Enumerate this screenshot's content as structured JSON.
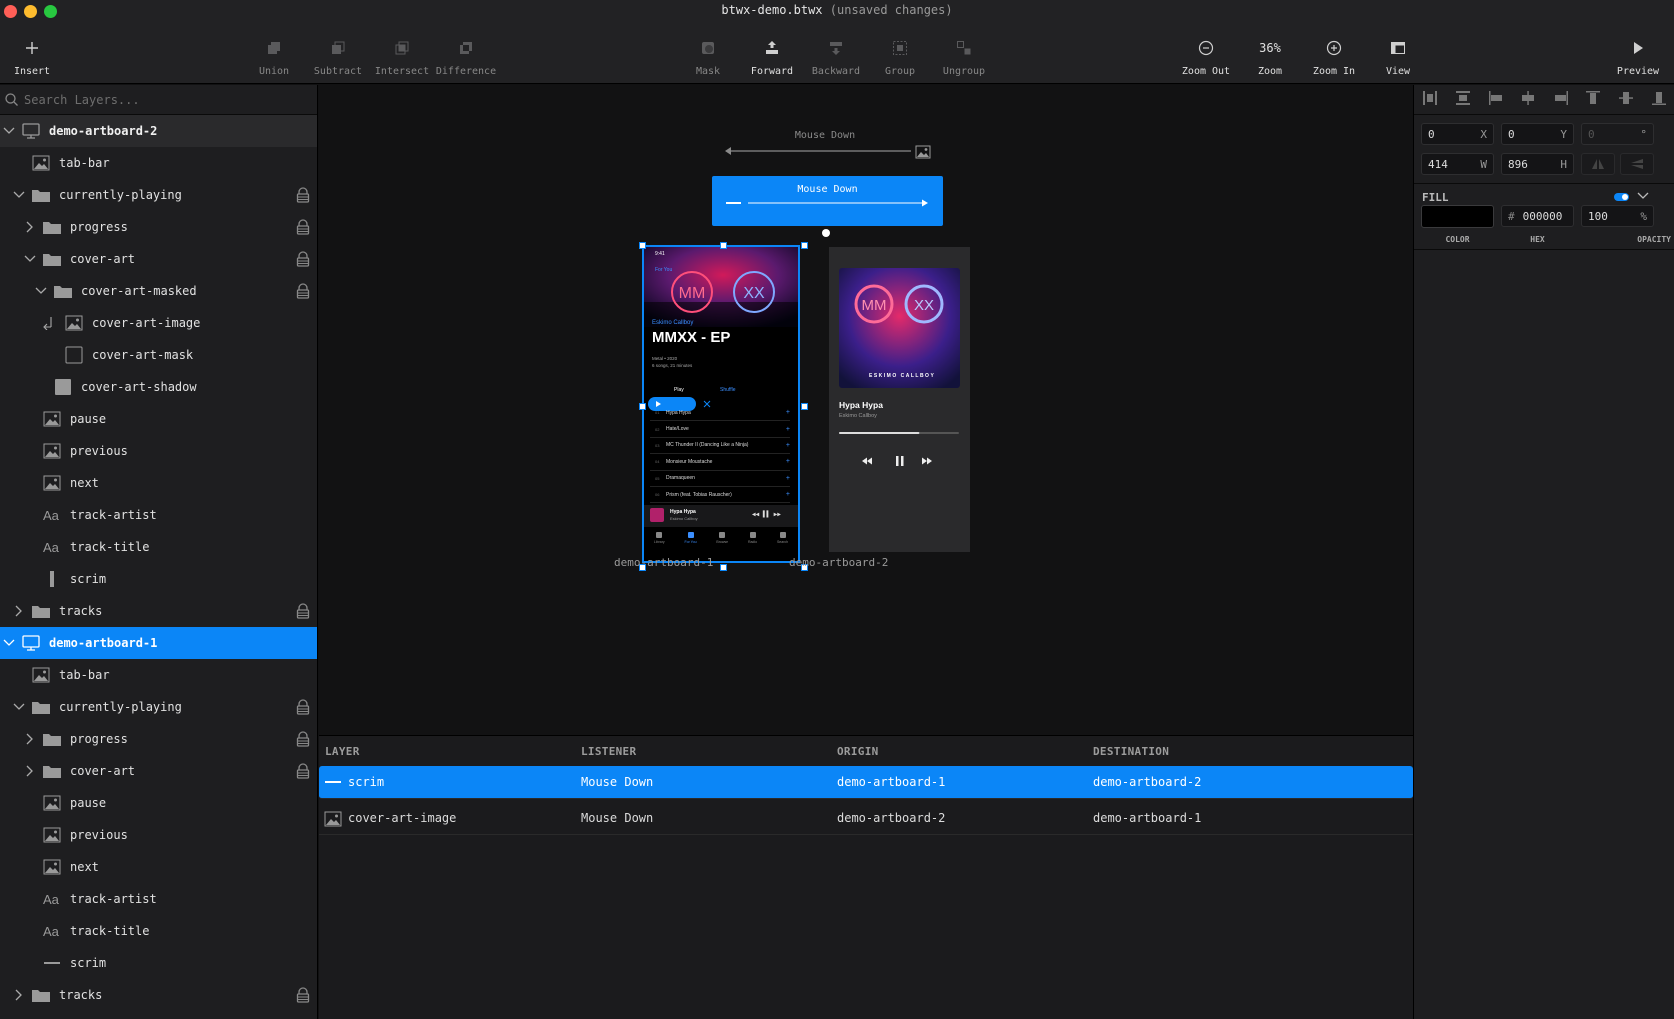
{
  "window": {
    "title": "btwx-demo.btwx",
    "subtitle": "(unsaved changes)"
  },
  "traffic_colors": {
    "close": "#ff5f57",
    "minimize": "#febc2e",
    "zoom": "#28c840"
  },
  "toolbar": {
    "insert": "Insert",
    "union": "Union",
    "subtract": "Subtract",
    "intersect": "Intersect",
    "difference": "Difference",
    "mask": "Mask",
    "forward": "Forward",
    "backward": "Backward",
    "group": "Group",
    "ungroup": "Ungroup",
    "zoom_out": "Zoom Out",
    "zoom_value": "36%",
    "zoom": "Zoom",
    "zoom_in": "Zoom In",
    "view": "View",
    "preview": "Preview"
  },
  "sidebar": {
    "search_placeholder": "Search Layers...",
    "layers": [
      {
        "name": "demo-artboard-2",
        "type": "artboard",
        "depth": 0,
        "expand": "down",
        "lock": false,
        "state": "artboard"
      },
      {
        "name": "tab-bar",
        "type": "image",
        "depth": 1,
        "expand": "none",
        "lock": false,
        "state": ""
      },
      {
        "name": "currently-playing",
        "type": "folder",
        "depth": 1,
        "expand": "down",
        "lock": true,
        "state": ""
      },
      {
        "name": "progress",
        "type": "folder",
        "depth": 2,
        "expand": "right",
        "lock": true,
        "state": ""
      },
      {
        "name": "cover-art",
        "type": "folder",
        "depth": 2,
        "expand": "down",
        "lock": true,
        "state": ""
      },
      {
        "name": "cover-art-masked",
        "type": "folder",
        "depth": 3,
        "expand": "down",
        "lock": true,
        "state": ""
      },
      {
        "name": "cover-art-image",
        "type": "masked-image",
        "depth": 4,
        "expand": "none",
        "lock": false,
        "state": ""
      },
      {
        "name": "cover-art-mask",
        "type": "shape-outline",
        "depth": 4,
        "expand": "none",
        "lock": false,
        "state": ""
      },
      {
        "name": "cover-art-shadow",
        "type": "shape-fill",
        "depth": 3,
        "expand": "none",
        "lock": false,
        "state": ""
      },
      {
        "name": "pause",
        "type": "image",
        "depth": 2,
        "expand": "none",
        "lock": false,
        "state": ""
      },
      {
        "name": "previous",
        "type": "image",
        "depth": 2,
        "expand": "none",
        "lock": false,
        "state": ""
      },
      {
        "name": "next",
        "type": "image",
        "depth": 2,
        "expand": "none",
        "lock": false,
        "state": ""
      },
      {
        "name": "track-artist",
        "type": "text",
        "depth": 2,
        "expand": "none",
        "lock": false,
        "state": ""
      },
      {
        "name": "track-title",
        "type": "text",
        "depth": 2,
        "expand": "none",
        "lock": false,
        "state": ""
      },
      {
        "name": "scrim",
        "type": "bar-vertical",
        "depth": 2,
        "expand": "none",
        "lock": false,
        "state": ""
      },
      {
        "name": "tracks",
        "type": "folder",
        "depth": 1,
        "expand": "right",
        "lock": true,
        "state": ""
      },
      {
        "name": "demo-artboard-1",
        "type": "artboard",
        "depth": 0,
        "expand": "down",
        "lock": false,
        "state": "selected"
      },
      {
        "name": "tab-bar",
        "type": "image",
        "depth": 1,
        "expand": "none",
        "lock": false,
        "state": ""
      },
      {
        "name": "currently-playing",
        "type": "folder",
        "depth": 1,
        "expand": "down",
        "lock": true,
        "state": ""
      },
      {
        "name": "progress",
        "type": "folder",
        "depth": 2,
        "expand": "right",
        "lock": true,
        "state": ""
      },
      {
        "name": "cover-art",
        "type": "folder",
        "depth": 2,
        "expand": "right",
        "lock": true,
        "state": ""
      },
      {
        "name": "pause",
        "type": "image",
        "depth": 2,
        "expand": "none",
        "lock": false,
        "state": ""
      },
      {
        "name": "previous",
        "type": "image",
        "depth": 2,
        "expand": "none",
        "lock": false,
        "state": ""
      },
      {
        "name": "next",
        "type": "image",
        "depth": 2,
        "expand": "none",
        "lock": false,
        "state": ""
      },
      {
        "name": "track-artist",
        "type": "text",
        "depth": 2,
        "expand": "none",
        "lock": false,
        "state": ""
      },
      {
        "name": "track-title",
        "type": "text",
        "depth": 2,
        "expand": "none",
        "lock": false,
        "state": ""
      },
      {
        "name": "scrim",
        "type": "bar-horizontal",
        "depth": 2,
        "expand": "none",
        "lock": false,
        "state": ""
      },
      {
        "name": "tracks",
        "type": "folder",
        "depth": 1,
        "expand": "right",
        "lock": true,
        "state": ""
      }
    ]
  },
  "canvas": {
    "event_top_label": "Mouse Down",
    "event_box_label": "Mouse Down",
    "artboard_1_label": "demo-artboard-1",
    "artboard_2_label": "demo-artboard-2",
    "phone1": {
      "time": "9:41",
      "back": "For You",
      "artist": "Eskimo Callboy",
      "title": "MMXX - EP",
      "meta1": "Metal • 2020",
      "meta2": "6 songs, 21 minutes",
      "play": "Play",
      "shuffle": "Shuffle",
      "tracks": [
        "Hypa Hypa",
        "Hate/Love",
        "MC Thunder II (Dancing Like a Ninja)",
        "Monsieur Moustache",
        "Dramaqueen",
        "Prism (feat. Tobias Rauscher)"
      ],
      "track_numbers": [
        "01",
        "02",
        "03",
        "04",
        "05",
        "06"
      ],
      "mini_title": "Hypa Hypa",
      "mini_artist": "Eskimo Callboy",
      "tabs": [
        "Library",
        "For You",
        "Browse",
        "Radio",
        "Search"
      ]
    },
    "phone2": {
      "cover_text": "ESKIMO CALLBOY",
      "title": "Hypa Hypa",
      "artist": "Eskimo Callboy",
      "progress": 0.67
    }
  },
  "inspector": {
    "x": "0",
    "x_label": "X",
    "y": "0",
    "y_label": "Y",
    "rotation": "0",
    "rotation_unit": "°",
    "w": "414",
    "w_label": "W",
    "h": "896",
    "h_label": "H",
    "fill_title": "FILL",
    "fill_color": "#000000",
    "hex": "000000",
    "hex_prefix": "#",
    "opacity": "100",
    "opacity_unit": "%",
    "color_label": "COLOR",
    "hex_label": "HEX",
    "opacity_label": "OPACITY"
  },
  "events_table": {
    "headers": [
      "LAYER",
      "LISTENER",
      "ORIGIN",
      "DESTINATION"
    ],
    "rows": [
      {
        "layer": "scrim",
        "listener": "Mouse Down",
        "origin": "demo-artboard-1",
        "destination": "demo-artboard-2",
        "selected": true
      },
      {
        "layer": "cover-art-image",
        "listener": "Mouse Down",
        "origin": "demo-artboard-2",
        "destination": "demo-artboard-1",
        "selected": false
      }
    ]
  },
  "colors": {
    "accent": "#0b86f7",
    "artboard_selected": "#0b86f7"
  }
}
